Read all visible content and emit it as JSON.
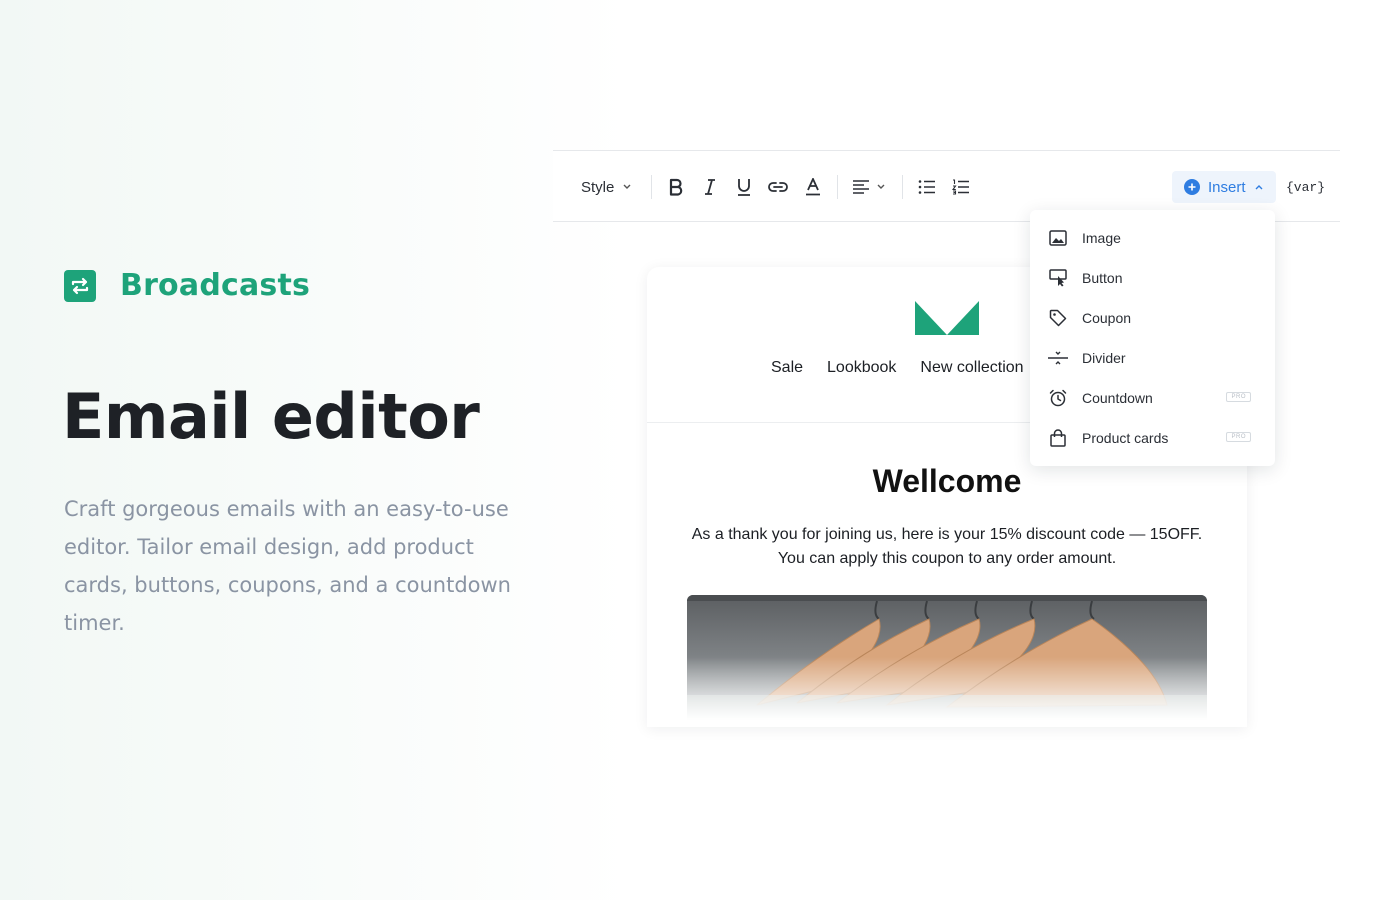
{
  "brand": {
    "name": "Broadcasts",
    "color": "#1ea37a"
  },
  "hero": {
    "title": "Email editor",
    "description": "Craft gorgeous emails with an easy-to-use editor. Tailor email design, add product cards, buttons, coupons, and a countdown timer."
  },
  "toolbar": {
    "style_label": "Style",
    "insert_label": "Insert",
    "var_label": "{var}",
    "buttons": [
      "bold-icon",
      "italic-icon",
      "underline-icon",
      "link-icon",
      "text-color-icon",
      "align-left-icon",
      "bullet-list-icon",
      "numbered-list-icon"
    ]
  },
  "insert_menu": {
    "items": [
      {
        "label": "Image",
        "icon": "image-icon",
        "pro": ""
      },
      {
        "label": "Button",
        "icon": "button-icon",
        "pro": ""
      },
      {
        "label": "Coupon",
        "icon": "tag-icon",
        "pro": ""
      },
      {
        "label": "Divider",
        "icon": "divider-icon",
        "pro": ""
      },
      {
        "label": "Countdown",
        "icon": "alarm-clock-icon",
        "pro": "PRO"
      },
      {
        "label": "Product cards",
        "icon": "shopping-bag-icon",
        "pro": "PRO"
      }
    ]
  },
  "email": {
    "nav": [
      "Sale",
      "Lookbook",
      "New collection"
    ],
    "heading": "Wellcome",
    "body": "As a thank you for joining us, here is your 15% discount code — 15OFF. You can apply this coupon to any order amount.",
    "accent_color": "#1ea37a"
  }
}
